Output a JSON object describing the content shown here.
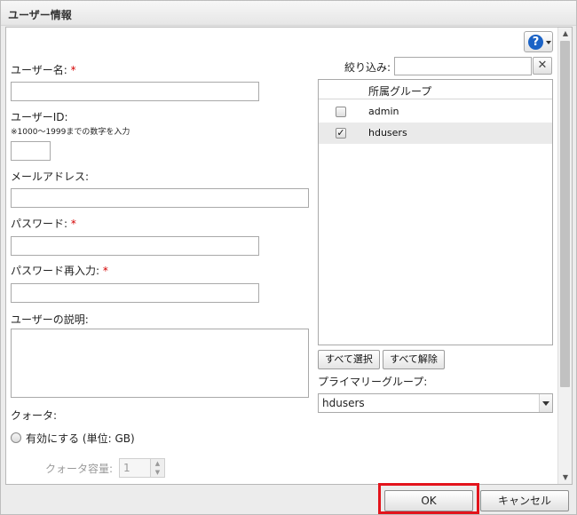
{
  "window": {
    "title": "ユーザー情報"
  },
  "help": {
    "icon": "help-icon",
    "glyph": "?"
  },
  "form": {
    "username_label": "ユーザー名:",
    "userid_label": "ユーザーID:",
    "userid_note": "※1000～1999までの数字を入力",
    "email_label": "メールアドレス:",
    "password_label": "パスワード:",
    "password_confirm_label": "パスワード再入力:",
    "description_label": "ユーザーの説明:",
    "required_mark": "*",
    "quota_label": "クォータ:",
    "quota_enable_label": "有効にする (単位: GB)",
    "quota_capacity_label": "クォータ容量:",
    "quota_capacity_value": "1"
  },
  "groups": {
    "filter_label": "絞り込み:",
    "filter_value": "",
    "clear_glyph": "✕",
    "column_header": "所属グループ",
    "rows": [
      {
        "name": "admin",
        "checked": false
      },
      {
        "name": "hdusers",
        "checked": true
      }
    ],
    "check_glyph": "✓",
    "select_all_label": "すべて選択",
    "clear_all_label": "すべて解除",
    "primary_label": "プライマリーグループ:",
    "primary_value": "hdusers"
  },
  "footer": {
    "ok_label": "OK",
    "cancel_label": "キャンセル"
  },
  "highlight_color": "#e3141c"
}
